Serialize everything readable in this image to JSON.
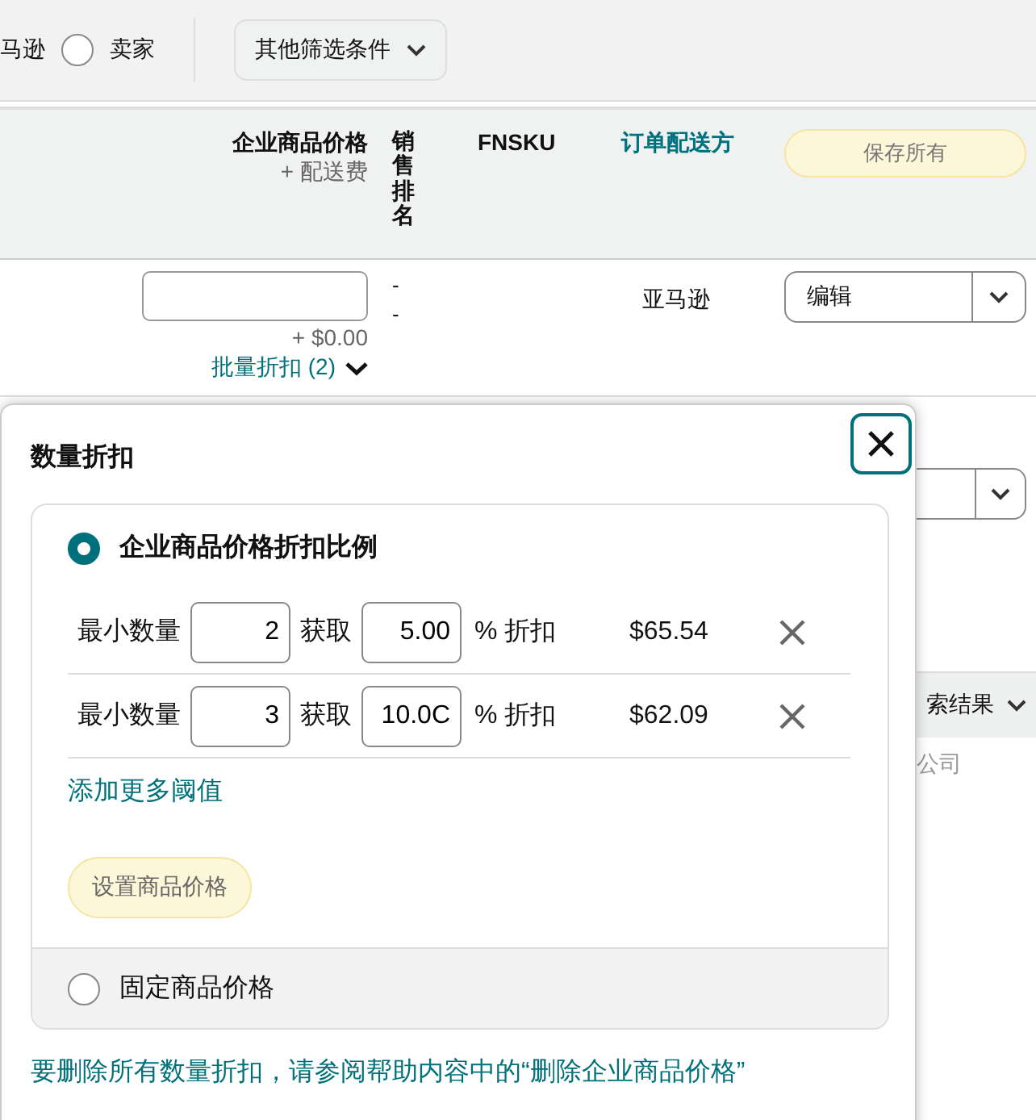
{
  "filter_bar": {
    "cut_label": "马逊",
    "radio_options": [
      {
        "label": "卖家",
        "selected": false
      }
    ],
    "filter_button": "其他筛选条件"
  },
  "table": {
    "columns": [
      {
        "label": "企业商品价格",
        "sublabel": "+ 配送费",
        "kind": "price"
      },
      {
        "label": "销售排名",
        "kind": "vertical"
      },
      {
        "label": "FNSKU",
        "kind": "plain"
      },
      {
        "label": "订单配送方",
        "kind": "link"
      }
    ],
    "save_button": "保存所有",
    "row": {
      "shipping": "+ $0.00",
      "bulk_discount": "批量折扣 (2)",
      "rank": [
        "-",
        "-"
      ],
      "fulfillment": "亚马逊",
      "action": "编辑"
    },
    "partial_row": {
      "dropdown_label": "索结果",
      "note": "公司"
    }
  },
  "popover": {
    "title": "数量折扣",
    "options": [
      {
        "label": "企业商品价格折扣比例",
        "selected": true,
        "tiers": [
          {
            "min_label": "最小数量",
            "min_qty": "2",
            "get_label": "获取",
            "percent": "5.00",
            "unit": "% 折扣",
            "price": "$65.54"
          },
          {
            "min_label": "最小数量",
            "min_qty": "3",
            "get_label": "获取",
            "percent": "10.0C",
            "unit": "% 折扣",
            "price": "$62.09"
          }
        ],
        "add_link": "添加更多阈值",
        "set_button": "设置商品价格"
      },
      {
        "label": "固定商品价格",
        "selected": false
      }
    ],
    "footer_note": "要删除所有数量折扣，请参阅帮助内容中的“删除企业商品价格”"
  }
}
